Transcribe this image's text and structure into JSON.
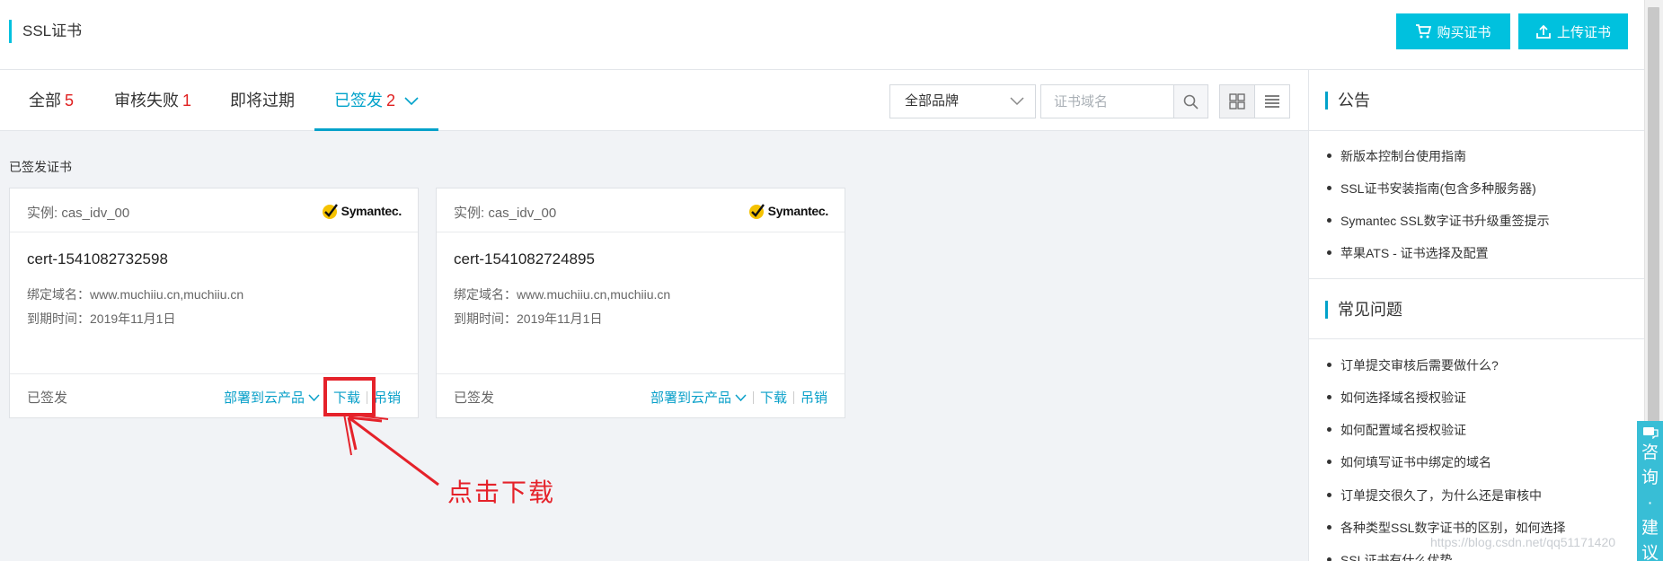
{
  "header": {
    "title": "SSL证书",
    "buy_label": "购买证书",
    "upload_label": "上传证书"
  },
  "tabs": [
    {
      "label": "全部",
      "count": "5"
    },
    {
      "label": "审核失败",
      "count": "1"
    },
    {
      "label": "即将过期",
      "count": ""
    },
    {
      "label": "已签发",
      "count": "2"
    }
  ],
  "filters": {
    "brand_select": "全部品牌",
    "search_placeholder": "证书域名"
  },
  "section_title": "已签发证书",
  "cards": [
    {
      "instance": "实例: cas_idv_00",
      "brand": "Symantec.",
      "cert_name": "cert-1541082732598",
      "domains": "绑定域名：www.muchiiu.cn,muchiiu.cn",
      "expire": "到期时间：2019年11月1日",
      "status": "已签发",
      "deploy_label": "部署到云产品",
      "download_label": "下载",
      "revoke_label": "吊销"
    },
    {
      "instance": "实例: cas_idv_00",
      "brand": "Symantec.",
      "cert_name": "cert-1541082724895",
      "domains": "绑定域名：www.muchiiu.cn,muchiiu.cn",
      "expire": "到期时间：2019年11月1日",
      "status": "已签发",
      "deploy_label": "部署到云产品",
      "download_label": "下载",
      "revoke_label": "吊销"
    }
  ],
  "annotation": {
    "text": "点击下载",
    "color": "#e5222a"
  },
  "sidebar": {
    "announcement_title": "公告",
    "announcements": [
      "新版本控制台使用指南",
      "SSL证书安装指南(包含多种服务器)",
      "Symantec SSL数字证书升级重签提示",
      "苹果ATS - 证书选择及配置"
    ],
    "faq_title": "常见问题",
    "faqs": [
      "订单提交审核后需要做什么?",
      "如何选择域名授权验证",
      "如何配置域名授权验证",
      "如何填写证书中绑定的域名",
      "订单提交很久了，为什么还是审核中",
      "各种类型SSL数字证书的区别，如何选择",
      "SSL证书有什么优势"
    ]
  },
  "float_button": "咨询·建议",
  "watermark": "https://blog.csdn.net/qq51171420",
  "colors": {
    "accent": "#00c1de",
    "link": "#0aa0c9",
    "count": "#e02020",
    "page_bg": "#f1f3f6"
  }
}
